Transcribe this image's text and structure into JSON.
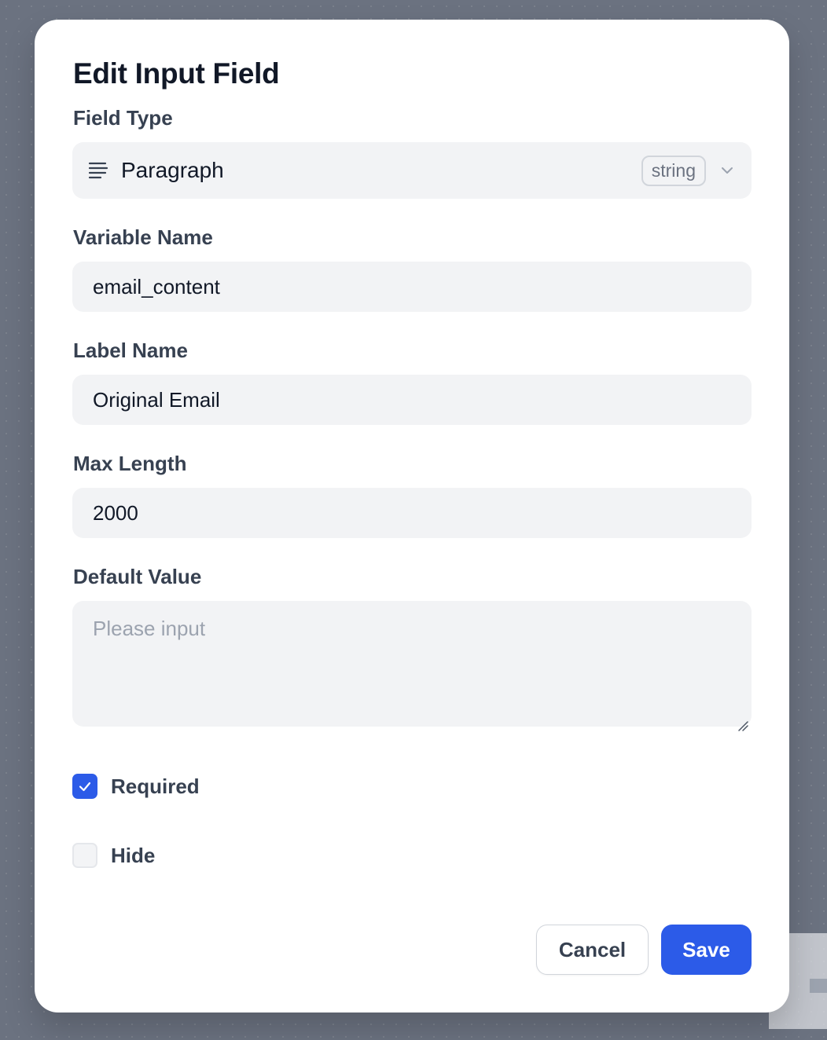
{
  "dialog": {
    "title": "Edit Input Field",
    "field_type": {
      "label": "Field Type",
      "selected": "Paragraph",
      "badge": "string",
      "icon": "paragraph-lines-icon"
    },
    "variable_name": {
      "label": "Variable Name",
      "value": "email_content"
    },
    "label_name": {
      "label": "Label Name",
      "value": "Original Email"
    },
    "max_length": {
      "label": "Max Length",
      "value": "2000"
    },
    "default_value": {
      "label": "Default Value",
      "value": "",
      "placeholder": "Please input"
    },
    "required": {
      "label": "Required",
      "checked": true
    },
    "hide": {
      "label": "Hide",
      "checked": false
    },
    "buttons": {
      "cancel": "Cancel",
      "save": "Save"
    }
  },
  "colors": {
    "accent": "#2c5be8",
    "overlay": "#6b7280",
    "field_bg": "#f2f3f5"
  }
}
